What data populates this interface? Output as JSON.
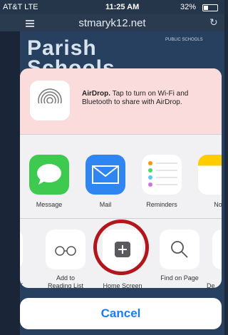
{
  "status": {
    "carrier": "AT&T  LTE",
    "time": "11:25 AM",
    "battery": "32%"
  },
  "browser": {
    "domain": "stmaryk12.net"
  },
  "page": {
    "headline_line1": "Parish",
    "headline_line2": "Schools",
    "badge": "PUBLIC SCHOOLS"
  },
  "airdrop": {
    "title": "AirDrop.",
    "description": " Tap to turn on Wi-Fi and Bluetooth to share with AirDrop."
  },
  "share_apps": [
    {
      "label": "Message",
      "icon": "message-icon"
    },
    {
      "label": "Mail",
      "icon": "mail-icon"
    },
    {
      "label": "Reminders",
      "icon": "reminders-icon"
    },
    {
      "label": "No",
      "icon": "notes-icon"
    }
  ],
  "actions": [
    {
      "label": "rk",
      "icon": "bookmark-icon"
    },
    {
      "label": "Add to\nReading List",
      "icon": "reading-list-icon"
    },
    {
      "label": "Home Screen",
      "icon": "add-icon"
    },
    {
      "label": "Find on Page",
      "icon": "search-icon"
    },
    {
      "label": "De",
      "icon": "desktop-icon"
    }
  ],
  "cancel_label": "Cancel",
  "colors": {
    "highlight_ring": "#b3151c",
    "cancel_text": "#1a7cf0",
    "airdrop_bg": "#fbdcdc"
  }
}
